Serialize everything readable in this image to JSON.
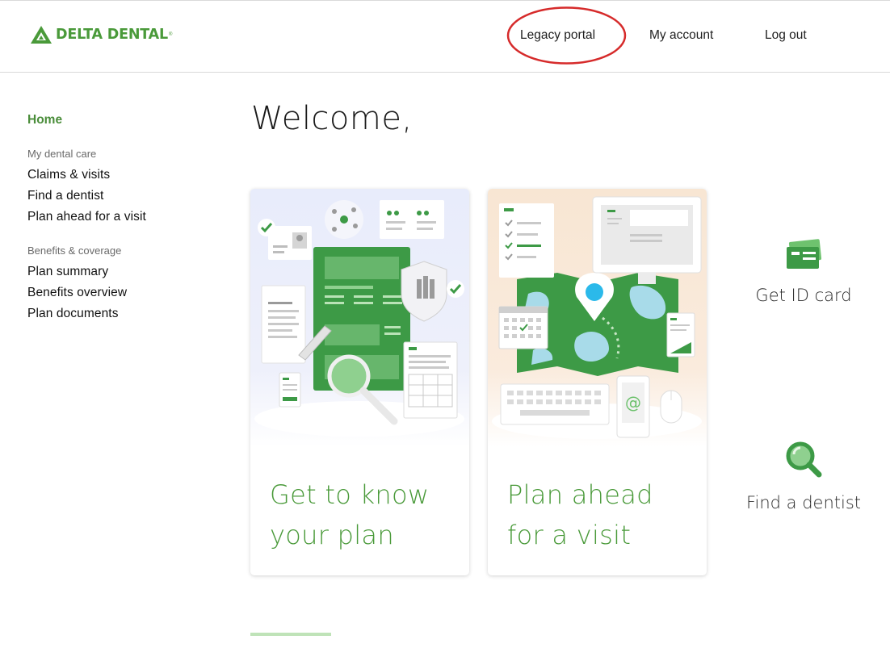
{
  "header": {
    "logo_text": "DELTA DENTAL",
    "logo_reg": "®",
    "nav": {
      "legacy_portal": "Legacy portal",
      "my_account": "My account",
      "log_out": "Log out"
    }
  },
  "sidebar": {
    "home": "Home",
    "sections": [
      {
        "title": "My dental care",
        "items": [
          "Claims & visits",
          "Find a dentist",
          "Plan ahead for a visit"
        ]
      },
      {
        "title": "Benefits & coverage",
        "items": [
          "Plan summary",
          "Benefits overview",
          "Plan documents"
        ]
      }
    ]
  },
  "main": {
    "welcome": "Welcome,",
    "cards": [
      {
        "title_line1": "Get to know",
        "title_line2": "your plan"
      },
      {
        "title_line1": "Plan ahead",
        "title_line2": "for a visit"
      }
    ],
    "quick_actions": {
      "id_card": "Get ID card",
      "find_dentist": "Find a dentist"
    }
  },
  "colors": {
    "brand_green": "#4a9a3a",
    "annotation_red": "#d62b2b",
    "light_green": "#bfe3b8"
  },
  "icons": {
    "logo": "delta-triangle-icon",
    "id_card": "id-card-icon",
    "find_dentist": "magnifier-icon"
  }
}
